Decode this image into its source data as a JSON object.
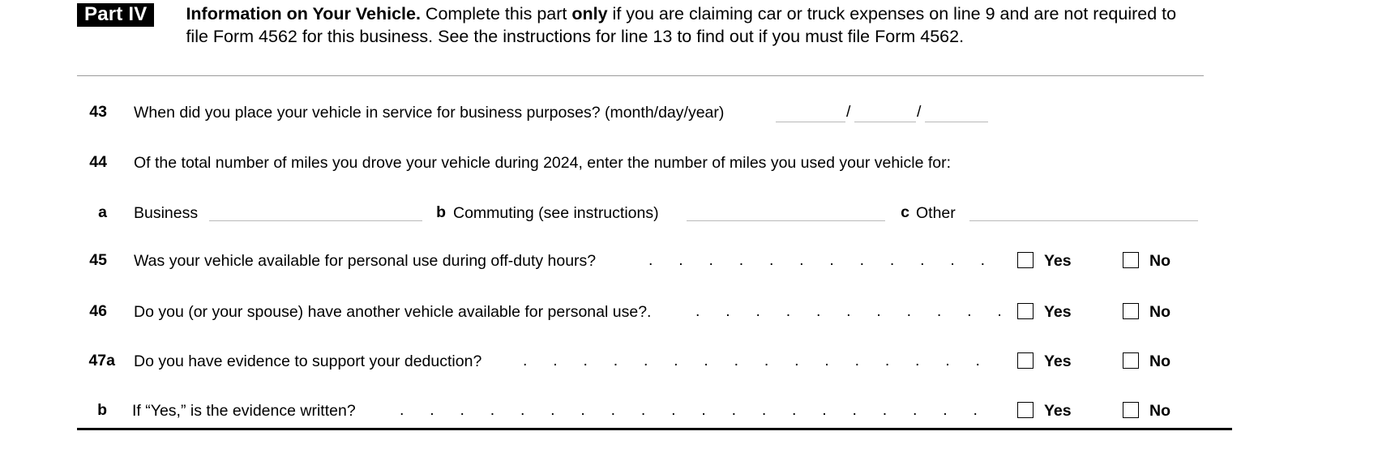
{
  "form": {
    "part_badge": "Part IV",
    "part_title_bold": "Information on Your Vehicle.",
    "part_intro_1": " Complete this part ",
    "part_intro_bold": "only",
    "part_intro_2": " if you are claiming car or truck expenses on line 9 and are not required to file Form 4562 for this business. See the instructions for line 13 to find out if you must file Form 4562.",
    "part_intro_full": "Complete this part only if you are claiming car or truck expenses on line 9 and are not required to file Form 4562 for this business. See the instructions for line 13 to find out if you must file Form 4562."
  },
  "lines": {
    "l43": {
      "number": "43",
      "text": "When did you place your vehicle in service for business purposes? (month/day/year)",
      "separator_1": "/",
      "separator_2": "/",
      "month_value": "",
      "day_value": "",
      "year_value": ""
    },
    "l44": {
      "number": "44",
      "text": "Of the total number of miles you drove your vehicle during 2024, enter the number of miles you used your vehicle for:",
      "year": "2024"
    },
    "l44a": {
      "letter": "a",
      "label": "Business",
      "value": ""
    },
    "l44b": {
      "letter": "b",
      "label": "Commuting (see instructions)",
      "value": ""
    },
    "l44c": {
      "letter": "c",
      "label": "Other",
      "value": ""
    },
    "l45": {
      "number": "45",
      "text": "Was your vehicle available for personal use during off-duty hours?",
      "yes_label": "Yes",
      "no_label": "No",
      "yes_checked": false,
      "no_checked": false
    },
    "l46": {
      "number": "46",
      "text": "Do you (or your spouse) have another vehicle available for personal use?.",
      "yes_label": "Yes",
      "no_label": "No",
      "yes_checked": false,
      "no_checked": false
    },
    "l47a": {
      "number": "47a",
      "text": "Do you have evidence to support your deduction?",
      "yes_label": "Yes",
      "no_label": "No",
      "yes_checked": false,
      "no_checked": false
    },
    "l47b": {
      "number": "b",
      "text": "If “Yes,” is the evidence written?",
      "yes_label": "Yes",
      "no_label": "No",
      "yes_checked": false,
      "no_checked": false
    }
  },
  "leaders": {
    "l45": ".  .  .  .  .  .  .  .  .  .  .  .  .  .  .  .",
    "l46": ".  .  .  .  .  .  .  .  .  .  .  .  .  .",
    "l47a": ".  .  .  .  .  .  .  .  .  .  .  .  .  .  .  .  .  .",
    "l47b": ".  .  .  .  .  .  .  .  .  .  .  .  .  .  .  .  .  .  .  .  ."
  },
  "colors": {
    "ink": "#000000",
    "badge_bg": "#000000",
    "badge_fg": "#ffffff",
    "rule_light": "#9a9a9a",
    "blank_line": "#b9b9b9",
    "page_bg": "#ffffff"
  }
}
